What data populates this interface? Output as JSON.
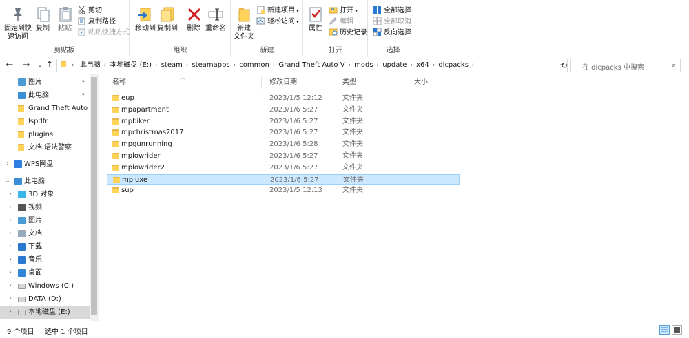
{
  "ribbon": {
    "clipboard": {
      "label": "剪贴板",
      "pin_quick_access": "固定到快\n速访问",
      "copy": "复制",
      "paste": "粘贴",
      "cut": "剪切",
      "copy_path": "复制路径",
      "paste_shortcut": "粘贴快捷方式"
    },
    "organize": {
      "label": "组织",
      "move_to": "移动到",
      "copy_to": "复制到",
      "delete": "删除",
      "rename": "重命名"
    },
    "new": {
      "label": "新建",
      "new_folder": "新建\n文件夹",
      "new_item": "新建项目",
      "easy_access": "轻松访问"
    },
    "open": {
      "label": "打开",
      "properties": "属性",
      "open": "打开",
      "edit": "编辑",
      "history": "历史记录"
    },
    "select": {
      "label": "选择",
      "select_all": "全部选择",
      "select_none": "全部取消",
      "invert": "反向选择"
    }
  },
  "address": {
    "crumbs": [
      "此电脑",
      "本地磁盘 (E:)",
      "steam",
      "steamapps",
      "common",
      "Grand Theft Auto V",
      "mods",
      "update",
      "x64",
      "dlcpacks"
    ],
    "search_placeholder": "在 dlcpacks 中搜索"
  },
  "nav": {
    "items": [
      {
        "label": "图片",
        "icon": "pictures-icon",
        "pinned": true,
        "selected": true
      },
      {
        "label": "此电脑",
        "icon": "computer-icon",
        "pinned": true
      },
      {
        "label": "Grand Theft Auto V",
        "icon": "folder-icon"
      },
      {
        "label": "lspdfr",
        "icon": "folder-icon"
      },
      {
        "label": "plugins",
        "icon": "folder-icon"
      },
      {
        "label": "文档 语法警察",
        "icon": "folder-icon"
      },
      {
        "label": "WPS网盘",
        "icon": "cloud-icon",
        "expandable": true
      },
      {
        "label": "此电脑",
        "icon": "computer-icon",
        "expanded": true
      },
      {
        "label": "3D 对象",
        "icon": "3d-objects-icon",
        "expandable": true
      },
      {
        "label": "视频",
        "icon": "videos-icon",
        "expandable": true
      },
      {
        "label": "图片",
        "icon": "pictures-icon",
        "expandable": true
      },
      {
        "label": "文档",
        "icon": "documents-icon",
        "expandable": true
      },
      {
        "label": "下载",
        "icon": "downloads-icon",
        "expandable": true
      },
      {
        "label": "音乐",
        "icon": "music-icon",
        "expandable": true
      },
      {
        "label": "桌面",
        "icon": "desktop-icon",
        "expandable": true
      },
      {
        "label": "Windows (C:)",
        "icon": "drive-icon",
        "expandable": true
      },
      {
        "label": "DATA (D:)",
        "icon": "drive-icon",
        "expandable": true
      },
      {
        "label": "本地磁盘 (E:)",
        "icon": "drive-icon",
        "expandable": true,
        "active": true
      }
    ]
  },
  "columns": {
    "name": "名称",
    "date": "修改日期",
    "type": "类型",
    "size": "大小"
  },
  "files": [
    {
      "name": "eup",
      "date": "2023/1/5 12:12",
      "type": "文件夹"
    },
    {
      "name": "mpapartment",
      "date": "2023/1/6 5:27",
      "type": "文件夹"
    },
    {
      "name": "mpbiker",
      "date": "2023/1/6 5:27",
      "type": "文件夹"
    },
    {
      "name": "mpchristmas2017",
      "date": "2023/1/6 5:27",
      "type": "文件夹"
    },
    {
      "name": "mpgunrunning",
      "date": "2023/1/6 5:28",
      "type": "文件夹"
    },
    {
      "name": "mplowrider",
      "date": "2023/1/6 5:27",
      "type": "文件夹"
    },
    {
      "name": "mplowrider2",
      "date": "2023/1/6 5:27",
      "type": "文件夹"
    },
    {
      "name": "mpluxe",
      "date": "2023/1/6 5:27",
      "type": "文件夹",
      "selected": true
    },
    {
      "name": "sup",
      "date": "2023/1/5 12:13",
      "type": "文件夹"
    }
  ],
  "status": {
    "count": "9 个项目",
    "selected": "选中 1 个项目"
  },
  "colors": {
    "accent": "#0078d7",
    "selection": "#cce8ff",
    "folder": "#ffd35a"
  }
}
